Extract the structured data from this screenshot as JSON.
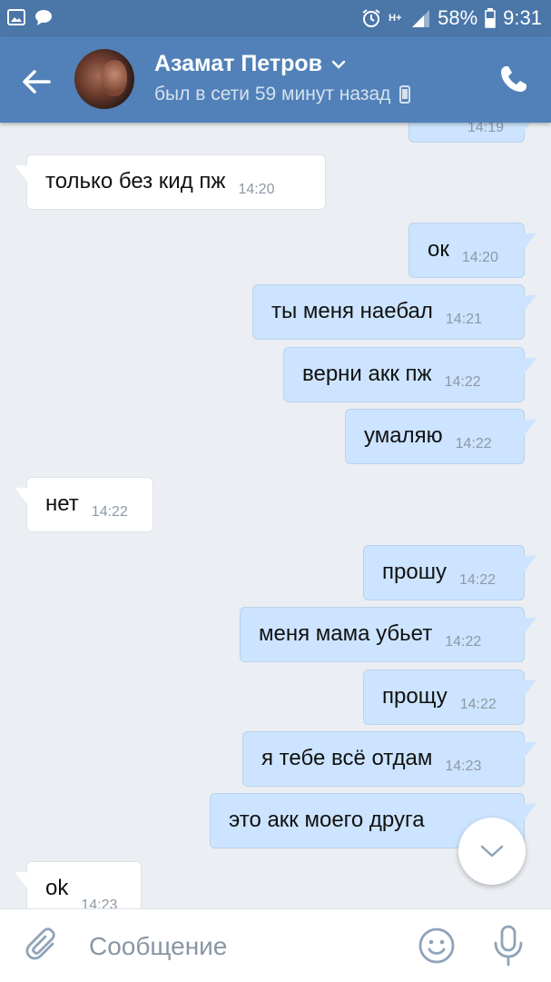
{
  "status_bar": {
    "network": "H+",
    "battery": "58%",
    "time": "9:31"
  },
  "header": {
    "contact_name": "Азамат Петров",
    "last_seen": "был в сети 59 минут назад"
  },
  "messages": [
    {
      "dir": "out",
      "text": "",
      "time": "14:19"
    },
    {
      "dir": "in",
      "text": "только без кид пж",
      "time": "14:20"
    },
    {
      "dir": "out",
      "text": "ок",
      "time": "14:20"
    },
    {
      "dir": "out",
      "text": "ты меня наебал",
      "time": "14:21"
    },
    {
      "dir": "out",
      "text": "верни акк пж",
      "time": "14:22"
    },
    {
      "dir": "out",
      "text": "умаляю",
      "time": "14:22"
    },
    {
      "dir": "in",
      "text": "нет",
      "time": "14:22"
    },
    {
      "dir": "out",
      "text": "прошу",
      "time": "14:22"
    },
    {
      "dir": "out",
      "text": "меня мама убьет",
      "time": "14:22"
    },
    {
      "dir": "out",
      "text": "прощу",
      "time": "14:22"
    },
    {
      "dir": "out",
      "text": "я тебе всё отдам",
      "time": "14:23"
    },
    {
      "dir": "out",
      "text": "это акк моего друга",
      "time": ""
    },
    {
      "dir": "in",
      "text": "ok",
      "time": "14:23"
    }
  ],
  "composer": {
    "placeholder": "Сообщение"
  },
  "icons": {
    "status_left": [
      "image-icon",
      "chat-bubble-icon"
    ],
    "status_right": [
      "alarm-icon",
      "network-type-icon",
      "signal-icon",
      "battery-icon"
    ],
    "header": [
      "back-arrow-icon",
      "chevron-down-icon",
      "mobile-device-icon",
      "phone-icon"
    ],
    "chat": [
      "chevron-down-icon"
    ],
    "composer": [
      "paperclip-icon",
      "emoji-icon",
      "microphone-icon"
    ]
  },
  "colors": {
    "header": "#5181b8",
    "status_bar": "#4a76a8",
    "chat_bg": "#ebeef2",
    "incoming_bubble": "#ffffff",
    "outgoing_bubble": "#cce4ff"
  }
}
